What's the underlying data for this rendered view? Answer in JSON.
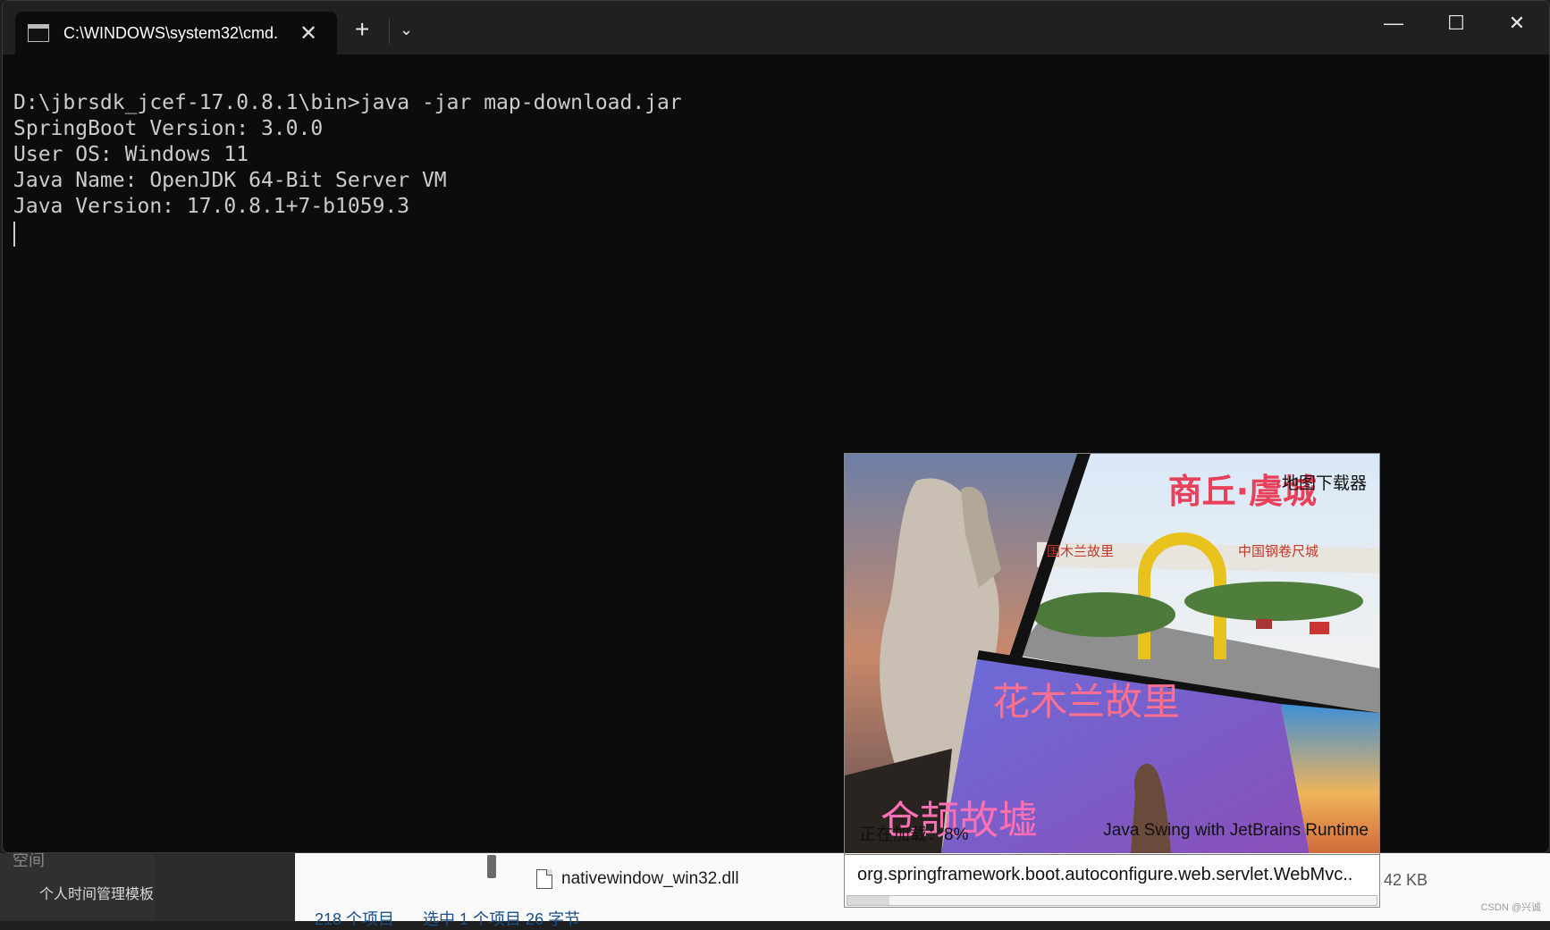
{
  "terminal": {
    "tab_title": "C:\\WINDOWS\\system32\\cmd.",
    "lines": [
      "D:\\jbrsdk_jcef-17.0.8.1\\bin>java -jar map-download.jar",
      "SpringBoot Version: 3.0.0",
      "User OS: Windows 11",
      "Java Name: OpenJDK 64-Bit Server VM",
      "Java Version: 17.0.8.1+7-b1059.3"
    ]
  },
  "splash": {
    "title": "地图下载器",
    "image_text": {
      "city": "商丘·虞城",
      "banner_left": "国木兰故里",
      "banner_right": "中国钢卷尺城",
      "mulan": "花木兰故里",
      "cangjie": "仓颉故墟"
    },
    "loading_text": "正在加载：8%",
    "progress": 8,
    "runtime_text": "Java Swing with JetBrains Runtime",
    "status_text": "org.springframework.boot.autoconfigure.web.servlet.WebMvc.."
  },
  "explorer": {
    "nav_top": "空间",
    "nav_item": "个人时间管理模板",
    "file_name": "nativewindow_win32.dll",
    "file_size": "42 KB",
    "status_count": "218 个项目",
    "status_selected": "选中 1 个项目  26 字节"
  },
  "watermark": "CSDN @兴诚"
}
